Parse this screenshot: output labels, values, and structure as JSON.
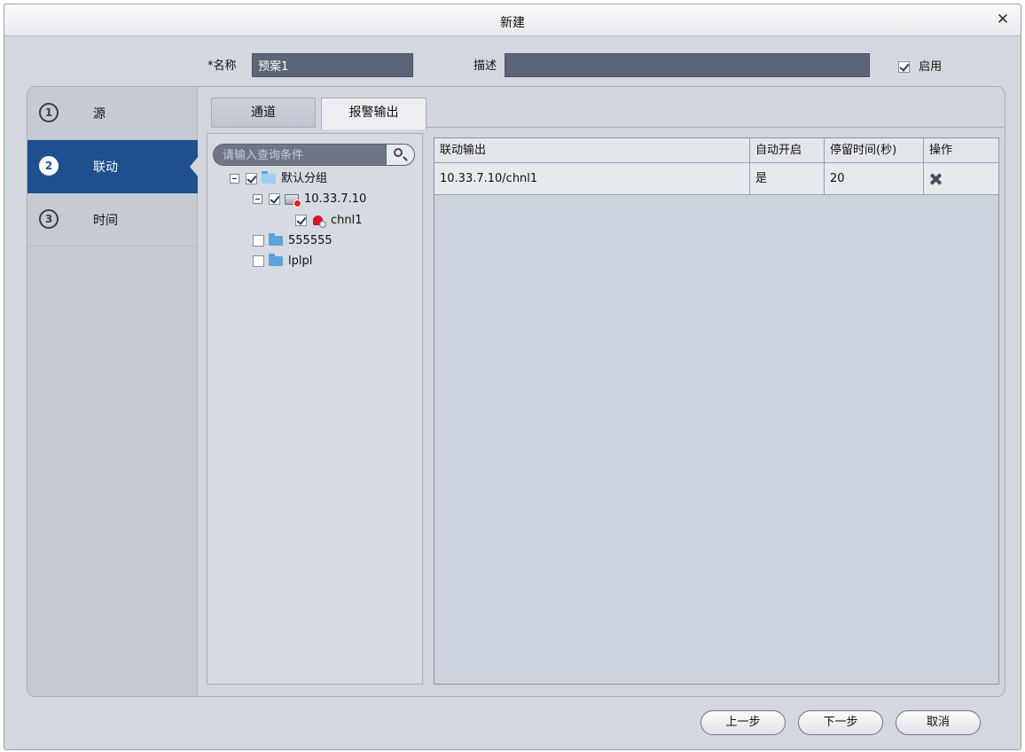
{
  "dialog": {
    "title": "新建",
    "close_icon": "close-icon"
  },
  "form": {
    "name_label": "*名称",
    "name_value": "预案1",
    "desc_label": "描述",
    "desc_value": "",
    "enable_label": "启用",
    "enable_checked": true
  },
  "steps": [
    {
      "num": "1",
      "label": "源",
      "active": false
    },
    {
      "num": "2",
      "label": "联动",
      "active": true
    },
    {
      "num": "3",
      "label": "时间",
      "active": false
    }
  ],
  "tabs": [
    {
      "label": "通道",
      "active": false
    },
    {
      "label": "报警输出",
      "active": true
    }
  ],
  "search": {
    "placeholder": "请输入查询条件",
    "icon": "search-icon"
  },
  "tree": {
    "group": {
      "label": "默认分组",
      "checked": true,
      "expanded": true
    },
    "device": {
      "label": "10.33.7.10",
      "checked": true,
      "expanded": true
    },
    "channel": {
      "label": "chnl1",
      "checked": true
    },
    "folders": [
      {
        "label": "555555",
        "checked": false
      },
      {
        "label": "lplpl",
        "checked": false
      }
    ]
  },
  "grid": {
    "columns": [
      "联动输出",
      "自动开启",
      "停留时间(秒)",
      "操作"
    ],
    "rows": [
      {
        "output": "10.33.7.10/chnl1",
        "auto": "是",
        "duration": "20",
        "action_icon": "delete-icon"
      }
    ]
  },
  "buttons": {
    "prev": "上一步",
    "next": "下一步",
    "cancel": "取消"
  }
}
